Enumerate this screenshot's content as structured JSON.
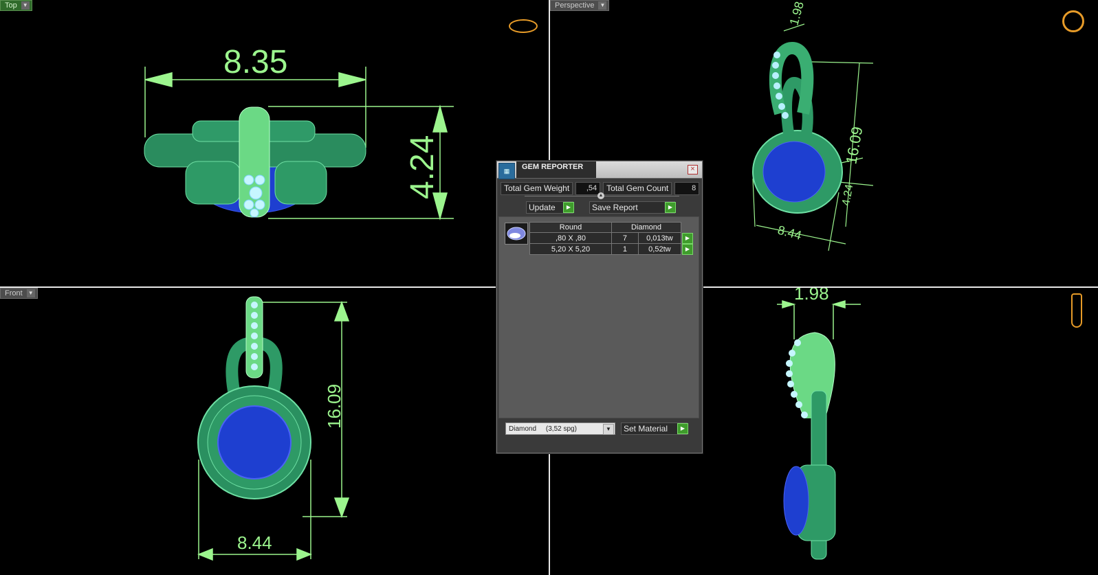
{
  "viewports": {
    "top": {
      "label": "Top",
      "width_dim": "8.35",
      "height_dim": "4.24"
    },
    "perspective": {
      "label": "Perspective",
      "dim_bail": "1.98",
      "dim_height": "16.09",
      "dim_width": "8.44",
      "dim_thick": "4.24"
    },
    "front": {
      "label": "Front",
      "dim_height": "16.09",
      "dim_width": "8.44"
    },
    "side": {
      "dim_bail": "1.98"
    }
  },
  "gem_reporter": {
    "title": "GEM REPORTER",
    "total_weight_label": "Total Gem Weight",
    "total_weight_value": ",54",
    "total_count_label": "Total Gem Count",
    "total_count_value": "8",
    "update_label": "Update",
    "save_report_label": "Save Report",
    "table": {
      "headers": [
        "Round",
        "Diamond"
      ],
      "rows": [
        {
          "size": ",80 X ,80",
          "count": "7",
          "weight": "0,013tw"
        },
        {
          "size": "5,20 X 5,20",
          "count": "1",
          "weight": "0,52tw"
        }
      ]
    },
    "material_select": "Diamond     (3,52 spg)",
    "set_material_label": "Set Material"
  },
  "colors": {
    "accent_green": "#9cf58e",
    "metal_green": "#2e9a66",
    "gem_blue": "#2236c8",
    "pave_light": "#b8f0ff"
  }
}
